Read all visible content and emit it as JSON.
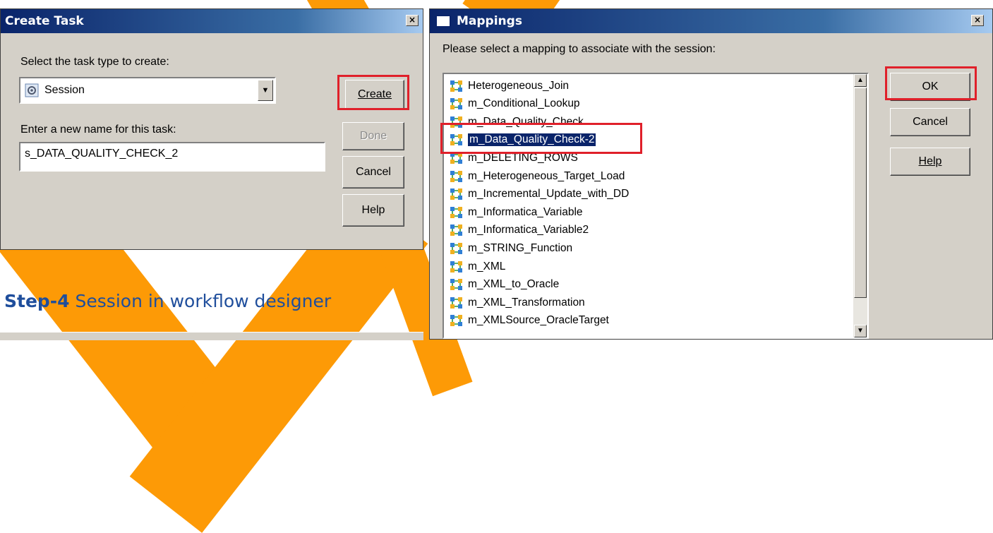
{
  "create_task": {
    "title": "Create Task",
    "close_glyph": "×",
    "select_label": "Select the task type to create:",
    "task_type_value": "Session",
    "name_label": "Enter a new name for this task:",
    "name_value": "s_DATA_QUALITY_CHECK_2",
    "buttons": {
      "create": "Create",
      "done": "Done",
      "cancel": "Cancel",
      "help": "Help"
    },
    "dropdown_glyph": "▼"
  },
  "mappings": {
    "title": "Mappings",
    "close_glyph": "×",
    "prompt": "Please select a mapping to associate with the session:",
    "items": [
      "Heterogeneous_Join",
      "m_Conditional_Lookup",
      "m_Data_Quality_Check",
      "m_Data_Quality_Check-2",
      "m_DELETING_ROWS",
      "m_Heterogeneous_Target_Load",
      "m_Incremental_Update_with_DD",
      "m_Informatica_Variable",
      "m_Informatica_Variable2",
      "m_STRING_Function",
      "m_XML",
      "m_XML_to_Oracle",
      "m_XML_Transformation",
      "m_XMLSource_OracleTarget"
    ],
    "selected_item": "m_Data_Quality_Check-2",
    "buttons": {
      "ok": "OK",
      "cancel": "Cancel",
      "help": "Help"
    },
    "scroll_up_glyph": "▲",
    "scroll_down_glyph": "▼"
  },
  "caption": {
    "step": "Step-4",
    "text": "Session in workflow designer"
  },
  "colors": {
    "accent_orange": "#fd9a06",
    "highlight_red": "#e0202a",
    "step_blue": "#1f4e9c",
    "selection_navy": "#0a246a"
  }
}
